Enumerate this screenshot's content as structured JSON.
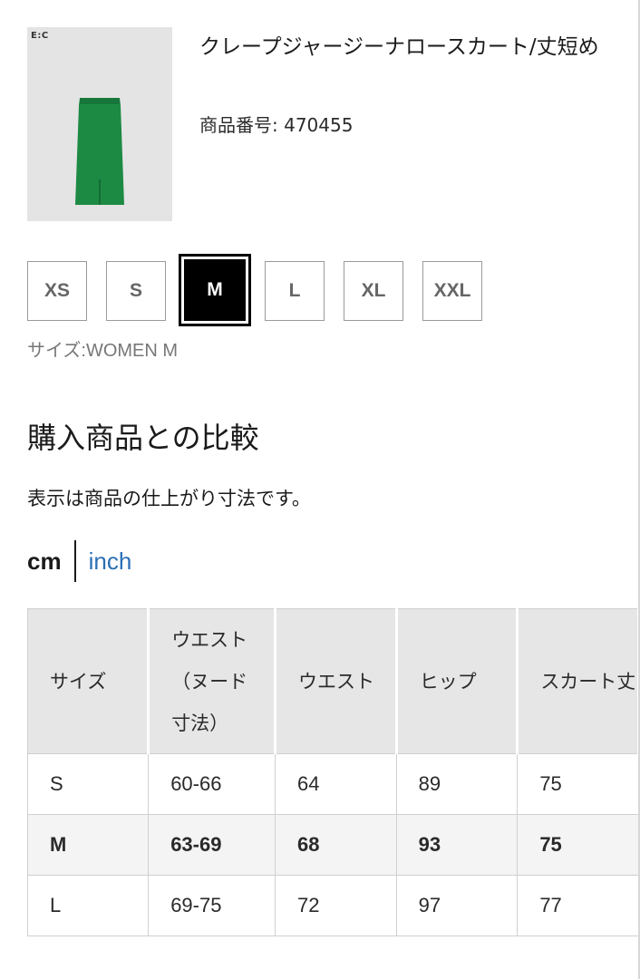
{
  "product": {
    "brand_mark": "E:C",
    "name": "クレープジャージーナロースカート/丈短め",
    "code_label": "商品番号: 470455",
    "image_color": "#1d8a44"
  },
  "sizes": {
    "options": [
      "XS",
      "S",
      "M",
      "L",
      "XL",
      "XXL"
    ],
    "selected": "M",
    "selected_label": "サイズ:WOMEN M"
  },
  "comparison": {
    "title": "購入商品との比較",
    "note": "表示は商品の仕上がり寸法です。",
    "unit_cm": "cm",
    "unit_inch": "inch"
  },
  "table": {
    "headers": [
      "サイズ",
      "ウエスト（ヌード寸法）",
      "ウエスト",
      "ヒップ",
      "スカート丈"
    ],
    "rows": [
      [
        "S",
        "60-66",
        "64",
        "89",
        "75"
      ],
      [
        "M",
        "63-69",
        "68",
        "93",
        "75"
      ],
      [
        "L",
        "69-75",
        "72",
        "97",
        "77"
      ]
    ],
    "highlight_row": 1
  },
  "colors": {
    "accent_link": "#2a6fb5",
    "selected_size_bg": "#000000",
    "table_header_bg": "#e6e6e6"
  }
}
